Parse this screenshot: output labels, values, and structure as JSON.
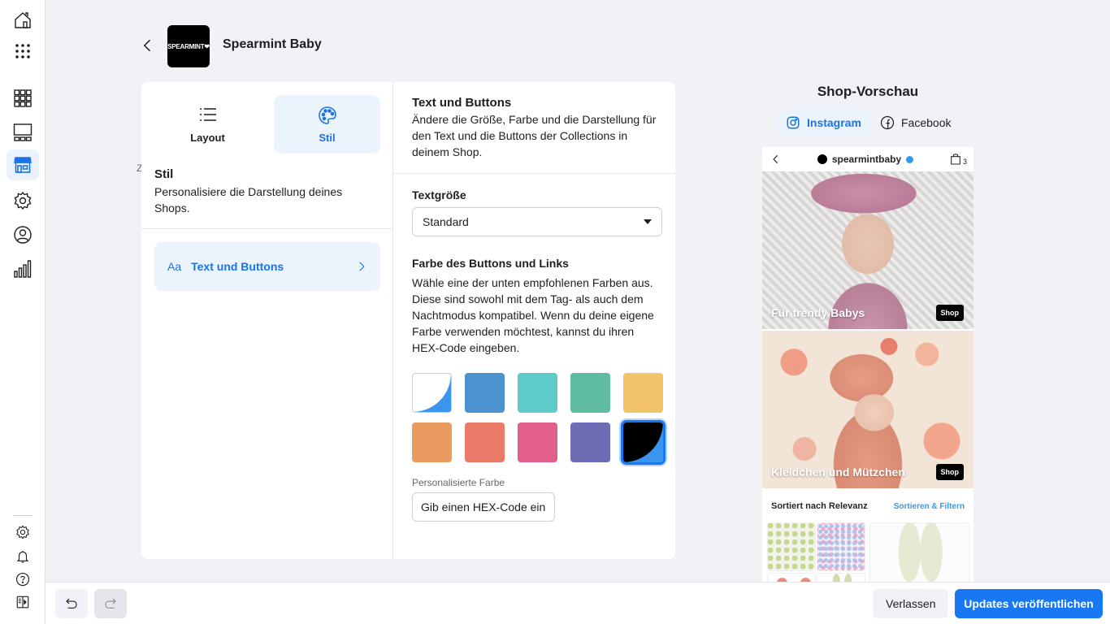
{
  "rail": {
    "items": [
      {
        "icon": "home-icon"
      },
      {
        "icon": "apps-icon"
      },
      {
        "icon": "grid-icon"
      },
      {
        "icon": "layout-icon"
      },
      {
        "icon": "storefront-icon",
        "active": true
      },
      {
        "icon": "gear-icon"
      },
      {
        "icon": "account-icon"
      },
      {
        "icon": "insights-icon"
      }
    ],
    "bottom_items": [
      {
        "icon": "settings-icon"
      },
      {
        "icon": "bell-icon"
      },
      {
        "icon": "help-icon"
      },
      {
        "icon": "panel-toggle-icon"
      }
    ]
  },
  "header": {
    "logo_text": "SPEARMINT❤",
    "shop_name": "Spearmint Baby"
  },
  "left_panel": {
    "tabs": [
      {
        "label": "Layout",
        "icon": "list-icon",
        "active": false
      },
      {
        "label": "Stil",
        "icon": "palette-icon",
        "active": true
      }
    ],
    "section_title": "Stil",
    "section_desc": "Personalisiere die Darstellung deines Shops.",
    "menu_items": [
      {
        "prefix": "Aa",
        "label": "Text und Buttons"
      }
    ],
    "stray_label": "Z"
  },
  "middle_panel": {
    "title": "Text und Buttons",
    "desc": "Ändere die Größe, Farbe und die Darstellung für den Text und die Buttons der Collections in deinem Shop.",
    "text_size": {
      "label": "Textgröße",
      "value": "Standard"
    },
    "button_color": {
      "label": "Farbe des Buttons und Links",
      "desc": "Wähle eine der unten empfohlenen Farben aus. Diese sind sowohl mit dem Tag- als auch dem Nachtmodus kompatibel. Wenn du deine eigene Farbe verwenden möchtest, kannst du ihren HEX-Code eingeben.",
      "swatches": [
        {
          "color": "#ffffff",
          "accent": "#3b94ee",
          "type": "split"
        },
        {
          "color": "#4a93cf"
        },
        {
          "color": "#5ecbcb"
        },
        {
          "color": "#5fbba1"
        },
        {
          "color": "#f2c469"
        },
        {
          "color": "#e99a5f"
        },
        {
          "color": "#ec7a68"
        },
        {
          "color": "#e15f8a"
        },
        {
          "color": "#6d6db6"
        },
        {
          "color": "#000000",
          "accent": "#3b94ee",
          "type": "split",
          "selected": true
        }
      ],
      "custom_label": "Personalisierte Farbe",
      "custom_placeholder": "Gib einen HEX-Code ein"
    }
  },
  "preview": {
    "title": "Shop-Vorschau",
    "tabs": [
      {
        "label": "Instagram",
        "icon": "instagram-icon",
        "active": true
      },
      {
        "label": "Facebook",
        "icon": "facebook-icon",
        "active": false
      }
    ],
    "phone": {
      "username": "spearmintbaby",
      "cart_count": "3",
      "collections": [
        {
          "title": "Für trendy Babys",
          "button": "Shop"
        },
        {
          "title": "Kleidchen und Mützchen",
          "button": "Shop"
        }
      ],
      "sort_label": "Sortiert nach Relevanz",
      "sort_link": "Sortieren & Filtern"
    }
  },
  "footer": {
    "leave_label": "Verlassen",
    "publish_label": "Updates veröffentlichen"
  },
  "colors": {
    "accent": "#1877f2",
    "accent_light": "#ebf3fd",
    "background": "#f0f2f5"
  }
}
